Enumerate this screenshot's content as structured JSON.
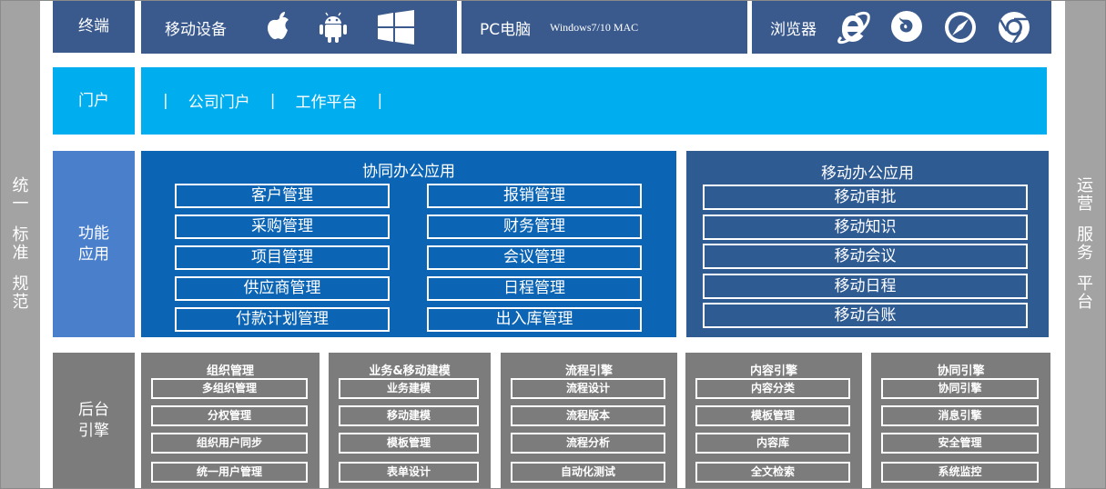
{
  "left_rail": [
    "统",
    "一",
    "标",
    "准",
    "规",
    "范"
  ],
  "right_rail": [
    "运",
    "营",
    "服",
    "务",
    "平",
    "台"
  ],
  "terminal": {
    "label": "终端",
    "mobile": {
      "label": "移动设备",
      "icons": [
        "apple-icon",
        "android-icon",
        "windows-icon"
      ]
    },
    "pc": {
      "label": "PC电脑",
      "os": "Windows7/10 MAC"
    },
    "browser": {
      "label": "浏览器",
      "icons": [
        "ie-icon",
        "firefox-icon",
        "safari-icon",
        "chrome-icon"
      ]
    }
  },
  "portal": {
    "label": "门户",
    "sep": "|",
    "items": [
      "公司门户",
      "工作平台"
    ]
  },
  "functions": {
    "label_lines": [
      "功能",
      "应用"
    ],
    "collab": {
      "title": "协同办公应用",
      "left": [
        "客户管理",
        "采购管理",
        "项目管理",
        "供应商管理",
        "付款计划管理"
      ],
      "right": [
        "报销管理",
        "财务管理",
        "会议管理",
        "日程管理",
        "出入库管理"
      ]
    },
    "mobile": {
      "title": "移动办公应用",
      "items": [
        "移动审批",
        "移动知识",
        "移动会议",
        "移动日程",
        "移动台账"
      ]
    }
  },
  "backend": {
    "label_lines": [
      "后台",
      "引擎"
    ],
    "groups": [
      {
        "title": "组织管理",
        "items": [
          "多组织管理",
          "分权管理",
          "组织用户同步",
          "统一用户管理"
        ]
      },
      {
        "title": "业务&移动建模",
        "items": [
          "业务建模",
          "移动建模",
          "模板管理",
          "表单设计"
        ]
      },
      {
        "title": "流程引擎",
        "items": [
          "流程设计",
          "流程版本",
          "流程分析",
          "自动化测试"
        ]
      },
      {
        "title": "内容引擎",
        "items": [
          "内容分类",
          "模板管理",
          "内容库",
          "全文检索"
        ]
      },
      {
        "title": "协同引擎",
        "items": [
          "协同引擎",
          "消息引擎",
          "安全管理",
          "系统监控"
        ]
      }
    ]
  },
  "colors": {
    "navy": "#3a5a8e",
    "cyan": "#00aeef",
    "blue_label": "#4a7fcb",
    "collab_blue": "#0c64b4",
    "mobile_blue": "#2f5b93",
    "backend_gray": "#7c7c7c",
    "rail_gray": "#a3a3a3"
  }
}
